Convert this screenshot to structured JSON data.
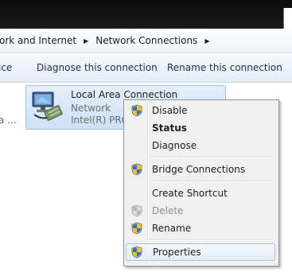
{
  "breadcrumb": {
    "items": [
      "ork and Internet",
      "Network Connections"
    ]
  },
  "commandbar": {
    "left_fragment": "ice",
    "diagnose_label": "Diagnose this connection",
    "rename_label": "Rename this connection"
  },
  "content": {
    "left_fragment": "a ...",
    "item": {
      "title": "Local Area Connection",
      "status": "Network",
      "device": "Intel(R) PRO/"
    }
  },
  "context_menu": {
    "items": [
      {
        "label": "Disable",
        "icon": "uac-shield-icon"
      },
      {
        "label": "Status"
      },
      {
        "label": "Diagnose"
      },
      {
        "label": "Bridge Connections",
        "icon": "uac-shield-icon"
      },
      {
        "label": "Create Shortcut"
      },
      {
        "label": "Delete",
        "icon": "uac-shield-icon",
        "disabled": true
      },
      {
        "label": "Rename",
        "icon": "uac-shield-icon"
      },
      {
        "label": "Properties",
        "icon": "uac-shield-icon",
        "hovered": true
      }
    ]
  },
  "colors": {
    "selection": "#cfe1f6",
    "menu_background": "#f0f0f0",
    "titlebar": "#111111"
  }
}
